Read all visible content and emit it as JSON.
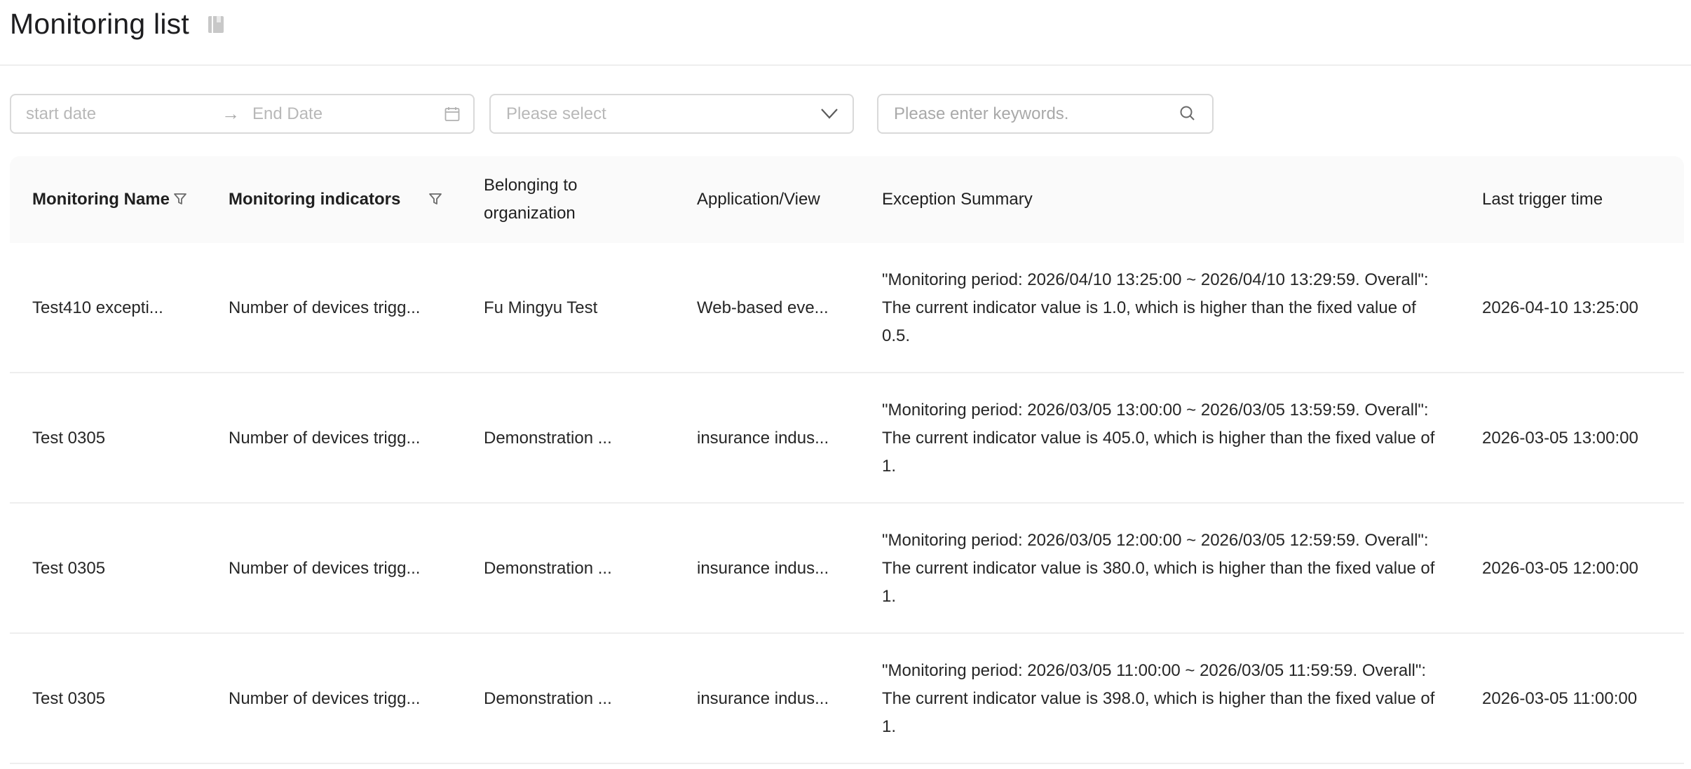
{
  "page": {
    "title": "Monitoring list",
    "title_icon": "book-icon"
  },
  "filters": {
    "date_start_placeholder": "start date",
    "date_arrow": "→",
    "date_end_placeholder": "End Date",
    "select_placeholder": "Please select",
    "search_placeholder": "Please enter keywords."
  },
  "table": {
    "columns": [
      "Monitoring Name",
      "Monitoring indicators",
      "Belonging to organization",
      "Application/View",
      "Exception Summary",
      "Last trigger time"
    ],
    "rows": [
      {
        "name": "Test410 excepti...",
        "indicator": "Number of devices trigg...",
        "org": "Fu Mingyu Test",
        "app": "Web-based eve...",
        "summary": "\"Monitoring period: 2026/04/10 13:25:00 ~ 2026/04/10 13:29:59. Overall\": The current indicator value is 1.0, which is higher than the fixed value of 0.5.",
        "time": "2026-04-10 13:25:00"
      },
      {
        "name": "Test 0305",
        "indicator": "Number of devices trigg...",
        "org": "Demonstration ...",
        "app": "insurance indus...",
        "summary": "\"Monitoring period: 2026/03/05 13:00:00 ~ 2026/03/05 13:59:59. Overall\": The current indicator value is 405.0, which is higher than the fixed value of 1.",
        "time": "2026-03-05 13:00:00"
      },
      {
        "name": "Test 0305",
        "indicator": "Number of devices trigg...",
        "org": "Demonstration ...",
        "app": "insurance indus...",
        "summary": "\"Monitoring period: 2026/03/05 12:00:00 ~ 2026/03/05 12:59:59. Overall\": The current indicator value is 380.0, which is higher than the fixed value of 1.",
        "time": "2026-03-05 12:00:00"
      },
      {
        "name": "Test 0305",
        "indicator": "Number of devices trigg...",
        "org": "Demonstration ...",
        "app": "insurance indus...",
        "summary": "\"Monitoring period: 2026/03/05 11:00:00 ~ 2026/03/05 11:59:59. Overall\": The current indicator value is 398.0, which is higher than the fixed value of 1.",
        "time": "2026-03-05 11:00:00"
      }
    ]
  }
}
